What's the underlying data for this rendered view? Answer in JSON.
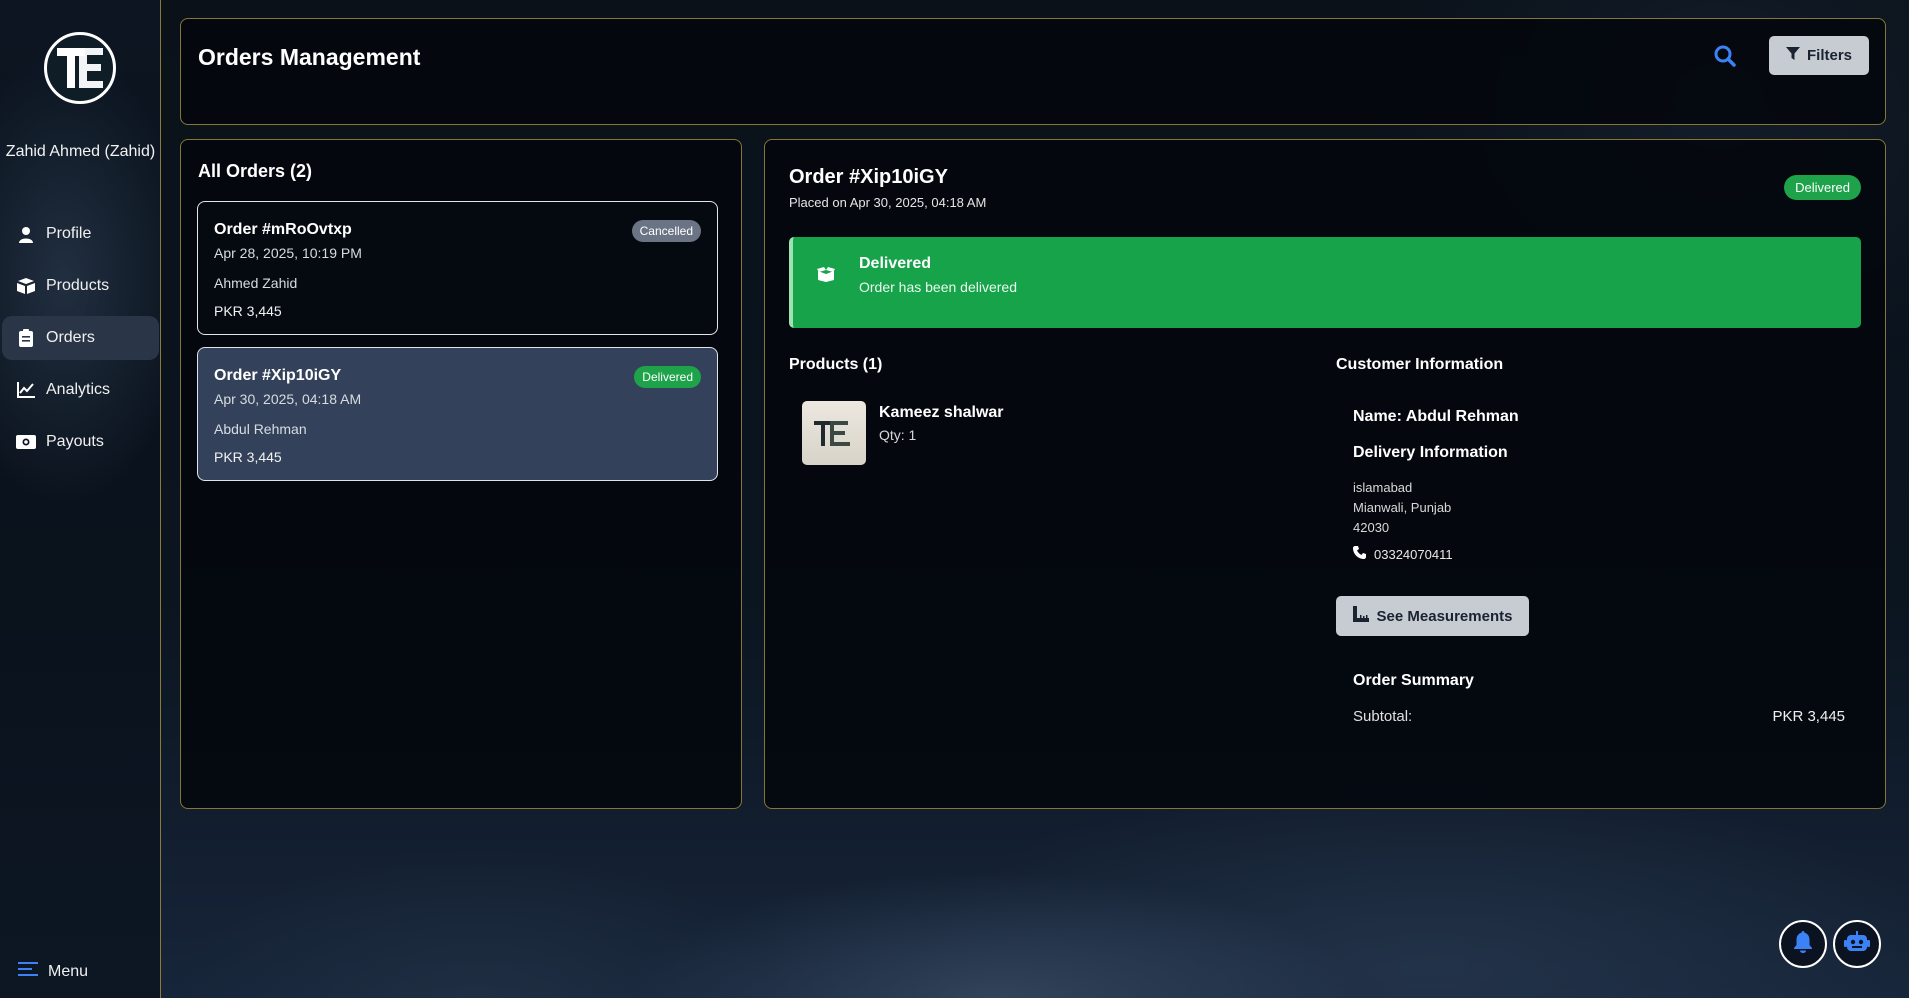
{
  "sidebar": {
    "user_name": "Zahid Ahmed (Zahid)",
    "logo_text": "TE",
    "items": [
      {
        "label": "Profile",
        "icon": "user-icon"
      },
      {
        "label": "Products",
        "icon": "box-icon"
      },
      {
        "label": "Orders",
        "icon": "clipboard-icon",
        "active": true
      },
      {
        "label": "Analytics",
        "icon": "chart-line-icon"
      },
      {
        "label": "Payouts",
        "icon": "money-icon"
      }
    ],
    "menu_label": "Menu"
  },
  "header": {
    "title": "Orders Management",
    "filters_label": "Filters"
  },
  "orders": {
    "title": "All Orders (2)",
    "list": [
      {
        "id": "Order #mRoOvtxp",
        "date": "Apr 28, 2025, 10:19 PM",
        "customer": "Ahmed Zahid",
        "price": "PKR 3,445",
        "status": "Cancelled",
        "status_color": "#6b7484"
      },
      {
        "id": "Order #Xip10iGY",
        "date": "Apr 30, 2025, 04:18 AM",
        "customer": "Abdul Rehman",
        "price": "PKR 3,445",
        "status": "Delivered",
        "status_color": "#1ea34b",
        "selected": true
      }
    ]
  },
  "detail": {
    "title": "Order #Xip10iGY",
    "placed": "Placed on Apr 30, 2025, 04:18 AM",
    "status_badge": "Delivered",
    "status_banner": {
      "title": "Delivered",
      "description": "Order has been delivered",
      "color": "#16a34a"
    },
    "products_title": "Products (1)",
    "product": {
      "name": "Kameez shalwar",
      "qty": "Qty: 1",
      "thumb_text": "TE"
    },
    "customer_title": "Customer Information",
    "customer_name": "Name: Abdul Rehman",
    "delivery_title": "Delivery Information",
    "address_line1": "islamabad",
    "address_line2": "Mianwali, Punjab",
    "address_line3": "42030",
    "phone": "03324070411",
    "measurements_label": "See Measurements",
    "summary_title": "Order Summary",
    "subtotal_label": "Subtotal:",
    "subtotal_value": "PKR 3,445"
  }
}
